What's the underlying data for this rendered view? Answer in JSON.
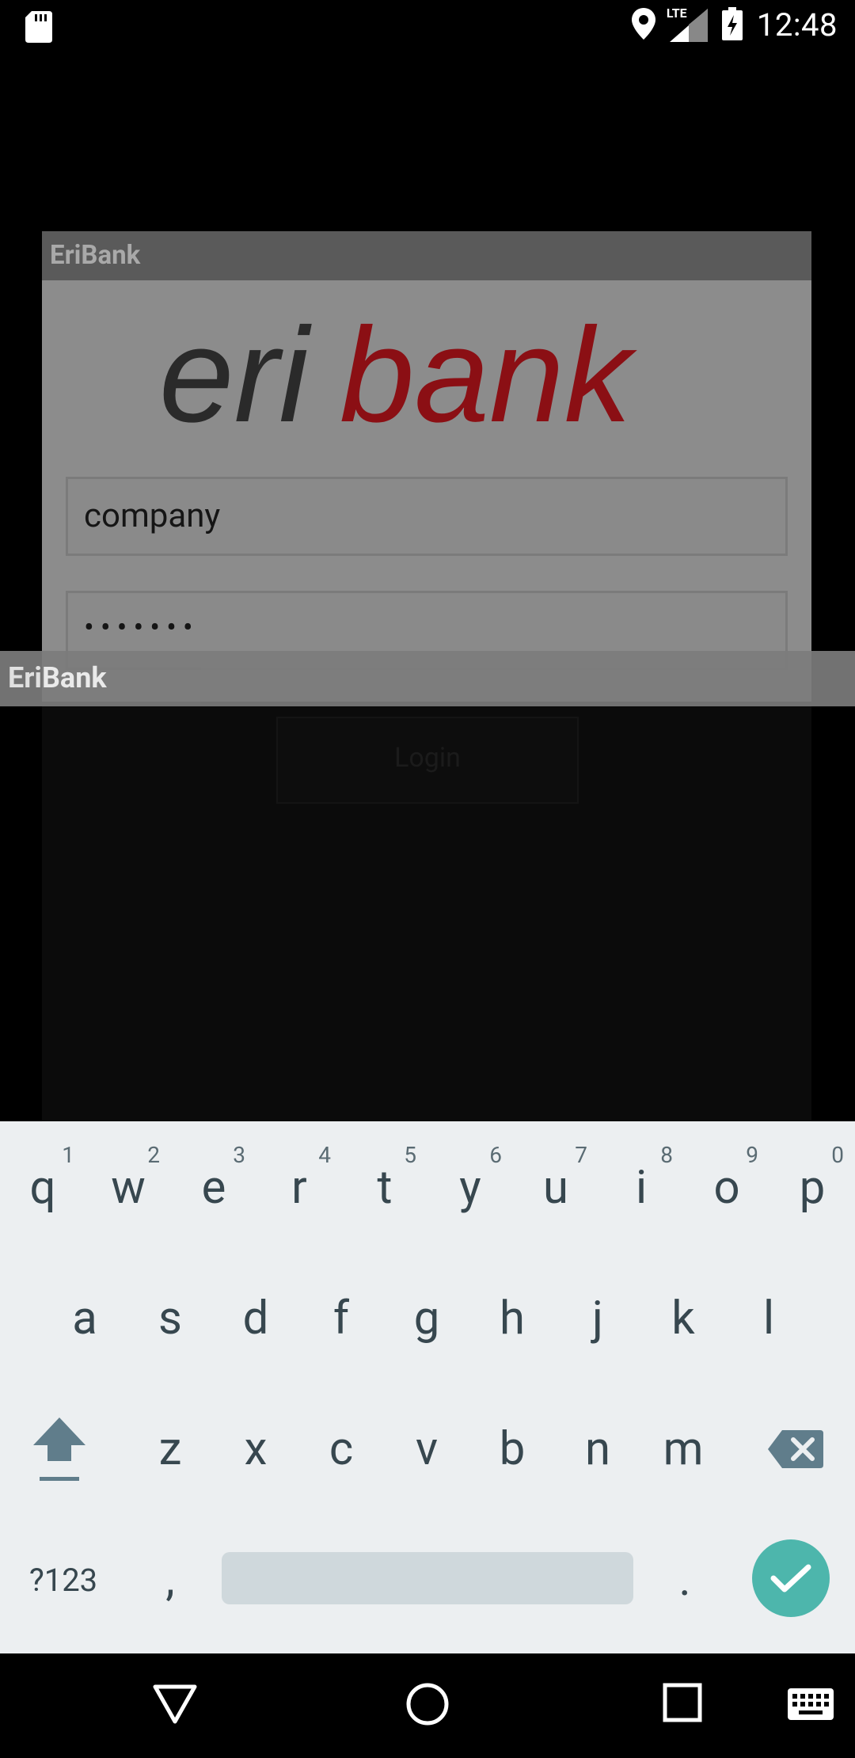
{
  "status_bar": {
    "time": "12:48",
    "network": "LTE",
    "icons": [
      "sd-card-icon",
      "location-icon",
      "signal-icon",
      "battery-charging-icon"
    ]
  },
  "dialog": {
    "title": "EriBank",
    "logo": {
      "part1": "eri",
      "part2": "bank"
    },
    "username_value": "company",
    "password_mask": "•••••••",
    "login_label": "Login"
  },
  "overlay": {
    "title": "EriBank"
  },
  "keyboard": {
    "row1": [
      {
        "key": "q",
        "hint": "1"
      },
      {
        "key": "w",
        "hint": "2"
      },
      {
        "key": "e",
        "hint": "3"
      },
      {
        "key": "r",
        "hint": "4"
      },
      {
        "key": "t",
        "hint": "5"
      },
      {
        "key": "y",
        "hint": "6"
      },
      {
        "key": "u",
        "hint": "7"
      },
      {
        "key": "i",
        "hint": "8"
      },
      {
        "key": "o",
        "hint": "9"
      },
      {
        "key": "p",
        "hint": "0"
      }
    ],
    "row2": [
      "a",
      "s",
      "d",
      "f",
      "g",
      "h",
      "j",
      "k",
      "l"
    ],
    "row3": [
      "z",
      "x",
      "c",
      "v",
      "b",
      "n",
      "m"
    ],
    "symbols_label": "?123",
    "comma": ",",
    "period": ".",
    "enter_icon": "check-icon",
    "shift_icon": "shift-icon",
    "backspace_icon": "backspace-icon"
  },
  "nav_bar": {
    "icons": [
      "back-icon",
      "home-icon",
      "recents-icon",
      "keyboard-switch-icon"
    ]
  },
  "colors": {
    "logo_dark": "#2a2a2a",
    "logo_red": "#8b0f14",
    "enter_teal": "#4db6ac",
    "keyboard_bg": "#eceff1",
    "key_text": "#37474f"
  }
}
